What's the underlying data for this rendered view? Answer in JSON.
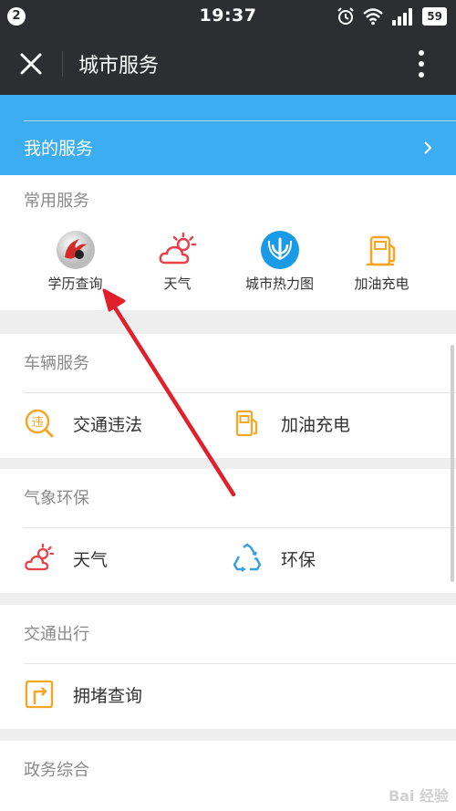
{
  "status_bar": {
    "notification_count": "2",
    "time": "19:37",
    "battery": "59"
  },
  "nav": {
    "title": "城市服务"
  },
  "my_service": {
    "label": "我的服务"
  },
  "sections": {
    "common": {
      "title": "常用服务",
      "items": [
        {
          "label": "学历查询",
          "icon": "education-logo-icon"
        },
        {
          "label": "天气",
          "icon": "weather-icon"
        },
        {
          "label": "城市热力图",
          "icon": "heatmap-icon"
        },
        {
          "label": "加油充电",
          "icon": "fuel-pump-icon"
        }
      ]
    },
    "vehicle": {
      "title": "车辆服务",
      "items": [
        {
          "label": "交通违法",
          "icon": "traffic-violation-icon"
        },
        {
          "label": "加油充电",
          "icon": "fuel-pump-icon"
        }
      ]
    },
    "weather_env": {
      "title": "气象环保",
      "items": [
        {
          "label": "天气",
          "icon": "weather-icon"
        },
        {
          "label": "环保",
          "icon": "recycle-icon"
        }
      ]
    },
    "traffic": {
      "title": "交通出行",
      "items": [
        {
          "label": "拥堵查询",
          "icon": "congestion-icon"
        }
      ]
    },
    "government": {
      "title": "政务综合"
    }
  },
  "colors": {
    "header_bg": "#2d2e32",
    "accent_blue": "#3badf0",
    "annotation_red": "#e0202b",
    "icon_orange": "#f5a623",
    "icon_red": "#e8414a",
    "icon_blue": "#1a9be8"
  },
  "watermark": "Bai 经验"
}
